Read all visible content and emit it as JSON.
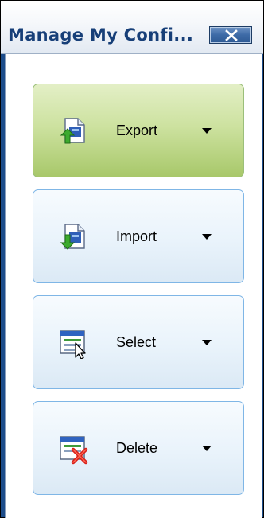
{
  "window": {
    "title": "Manage My Confi...",
    "close_icon": "close-icon"
  },
  "actions": [
    {
      "label": "Export",
      "icon": "export-icon",
      "state": "hover"
    },
    {
      "label": "Import",
      "icon": "import-icon",
      "state": "normal"
    },
    {
      "label": "Select",
      "icon": "select-icon",
      "state": "normal"
    },
    {
      "label": "Delete",
      "icon": "delete-icon",
      "state": "normal"
    }
  ],
  "colors": {
    "title_text": "#173f78",
    "button_border": "#7fb6e6",
    "hover_fill": "#cde2a0"
  }
}
